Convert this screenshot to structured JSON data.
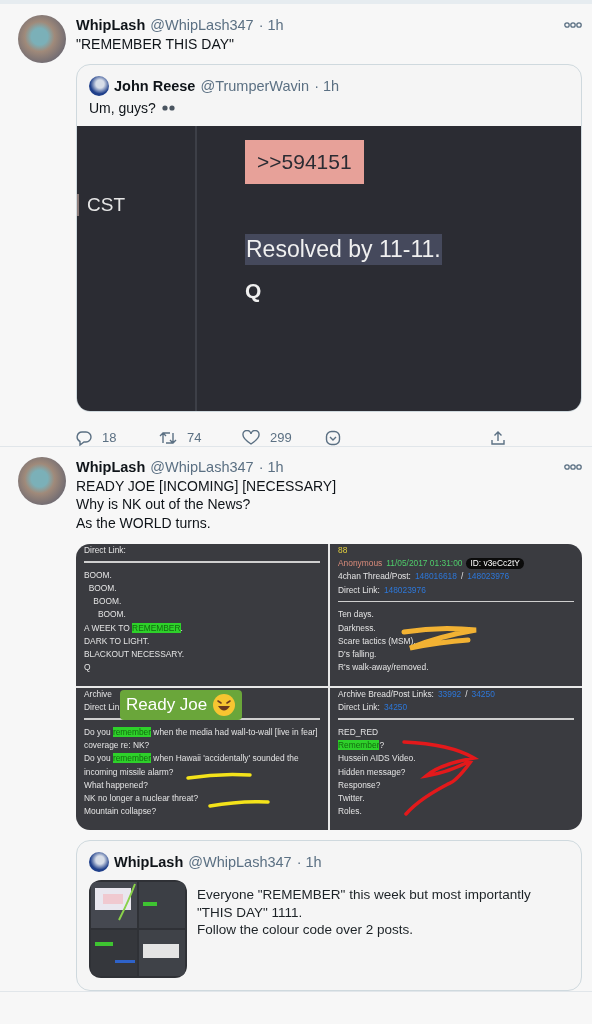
{
  "tweets": [
    {
      "author": "WhipLash",
      "handle": "@WhipLash347",
      "time": "· 1h",
      "text_lines": [
        "\"REMEMBER THIS DAY\""
      ],
      "quote": {
        "author": "John Reese",
        "handle": "@TrumperWavin",
        "time": "· 1h",
        "text": "Um, guys?",
        "screenshot": {
          "side_text": "CST",
          "post_ref": ">>594151",
          "highlighted": "Resolved by 11-11.",
          "signature": "Q"
        }
      },
      "actions": {
        "replies": "18",
        "retweets": "74",
        "likes": "299"
      }
    },
    {
      "author": "WhipLash",
      "handle": "@WhipLash347",
      "time": "· 1h",
      "text_lines": [
        "READY JOE [INCOMING] [NECESSARY]",
        "Why is NK out of the News?",
        "As the WORLD turns."
      ],
      "images": [
        {
          "header": [
            [
              {
                "kind": "label",
                "text": "Direct Link:"
              }
            ]
          ],
          "lines": [
            [
              {
                "kind": "plain",
                "text": "BOOM."
              }
            ],
            [
              {
                "kind": "plain",
                "text": "  BOOM."
              }
            ],
            [
              {
                "kind": "plain",
                "text": "    BOOM."
              }
            ],
            [
              {
                "kind": "plain",
                "text": "      BOOM."
              }
            ],
            [
              {
                "kind": "plain",
                "text": "A WEEK TO "
              },
              {
                "kind": "highlight",
                "text": "REMEMBER"
              },
              {
                "kind": "plain",
                "text": "."
              }
            ],
            [
              {
                "kind": "plain",
                "text": "DARK TO LIGHT."
              }
            ],
            [
              {
                "kind": "plain",
                "text": "BLACKOUT NECESSARY."
              }
            ],
            [
              {
                "kind": "plain",
                "text": "Q"
              }
            ]
          ]
        },
        {
          "header": [
            [
              {
                "kind": "count",
                "text": "88"
              }
            ],
            [
              {
                "kind": "name",
                "text": "Anonymous"
              },
              {
                "kind": "date",
                "text": "11/05/2017 01:31:00"
              },
              {
                "kind": "id",
                "text": "ID: v3eCc2tY"
              }
            ],
            [
              {
                "kind": "label",
                "text": "4chan Thread/Post:"
              },
              {
                "kind": "link",
                "text": "148016618"
              },
              {
                "kind": "label",
                "text": "/"
              },
              {
                "kind": "link",
                "text": "148023976"
              }
            ],
            [
              {
                "kind": "label",
                "text": "Direct Link:"
              },
              {
                "kind": "link",
                "text": "148023976"
              }
            ]
          ],
          "strokes": [
            {
              "kind": "zigzag",
              "color": "#f2b233"
            }
          ],
          "lines": [
            [
              {
                "kind": "plain",
                "text": "Ten days."
              }
            ],
            [
              {
                "kind": "plain",
                "text": "Darkness."
              }
            ],
            [
              {
                "kind": "plain",
                "text": "Scare tactics (MSM)."
              }
            ],
            [
              {
                "kind": "plain",
                "text": "D's falling."
              }
            ],
            [
              {
                "kind": "plain",
                "text": "R's walk-away/removed."
              }
            ]
          ]
        },
        {
          "header": [
            [
              {
                "kind": "label",
                "text": "Archive"
              }
            ],
            [
              {
                "kind": "label",
                "text": "Direct Lin"
              }
            ]
          ],
          "strokes": [
            {
              "kind": "underline-upper",
              "color": "#f4e31a"
            },
            {
              "kind": "underline-lower",
              "color": "#f4e31a"
            }
          ],
          "sticker": "Ready Joe",
          "lines": [
            [
              {
                "kind": "plain",
                "text": "Do you "
              },
              {
                "kind": "highlight",
                "text": "remember"
              },
              {
                "kind": "plain",
                "text": " when the media had wall-to-wall [live in fear] coverage re: NK?"
              }
            ],
            [
              {
                "kind": "plain",
                "text": "Do you "
              },
              {
                "kind": "highlight",
                "text": "remember"
              },
              {
                "kind": "plain",
                "text": " when Hawaii 'accidentally' sounded the incoming missile alarm?"
              }
            ],
            [
              {
                "kind": "plain",
                "text": "What happened?"
              }
            ],
            [
              {
                "kind": "plain",
                "text": "NK no longer a nuclear threat?"
              }
            ],
            [
              {
                "kind": "plain",
                "text": "Mountain collapse?"
              }
            ]
          ]
        },
        {
          "header": [
            [
              {
                "kind": "label",
                "text": "Archive Bread/Post Links:"
              },
              {
                "kind": "link",
                "text": "33992"
              },
              {
                "kind": "label",
                "text": "/"
              },
              {
                "kind": "link",
                "text": "34250"
              }
            ],
            [
              {
                "kind": "label",
                "text": "Direct Link:"
              },
              {
                "kind": "link",
                "text": "34250"
              }
            ]
          ],
          "strokes": [
            {
              "kind": "arrow",
              "color": "#e3191b"
            }
          ],
          "lines": [
            [
              {
                "kind": "plain",
                "text": "RED_RED"
              }
            ],
            [
              {
                "kind": "highlight",
                "text": "Remember"
              },
              {
                "kind": "plain",
                "text": "?"
              }
            ],
            [
              {
                "kind": "plain",
                "text": "Hussein AIDS Video."
              }
            ],
            [
              {
                "kind": "plain",
                "text": "Hidden message?"
              }
            ],
            [
              {
                "kind": "plain",
                "text": "Response?"
              }
            ],
            [
              {
                "kind": "plain",
                "text": "Twitter."
              }
            ],
            [
              {
                "kind": "plain",
                "text": "Roles."
              }
            ]
          ]
        }
      ],
      "quote": {
        "author": "WhipLash",
        "handle": "@WhipLash347",
        "time": "· 1h",
        "text_lines": [
          "Everyone \"REMEMBER\" this week but most importantly \"THIS DAY\" 1111.",
          "Follow the colour code over 2 posts."
        ],
        "thumbnail": {
          "kind": "picture"
        }
      }
    }
  ]
}
